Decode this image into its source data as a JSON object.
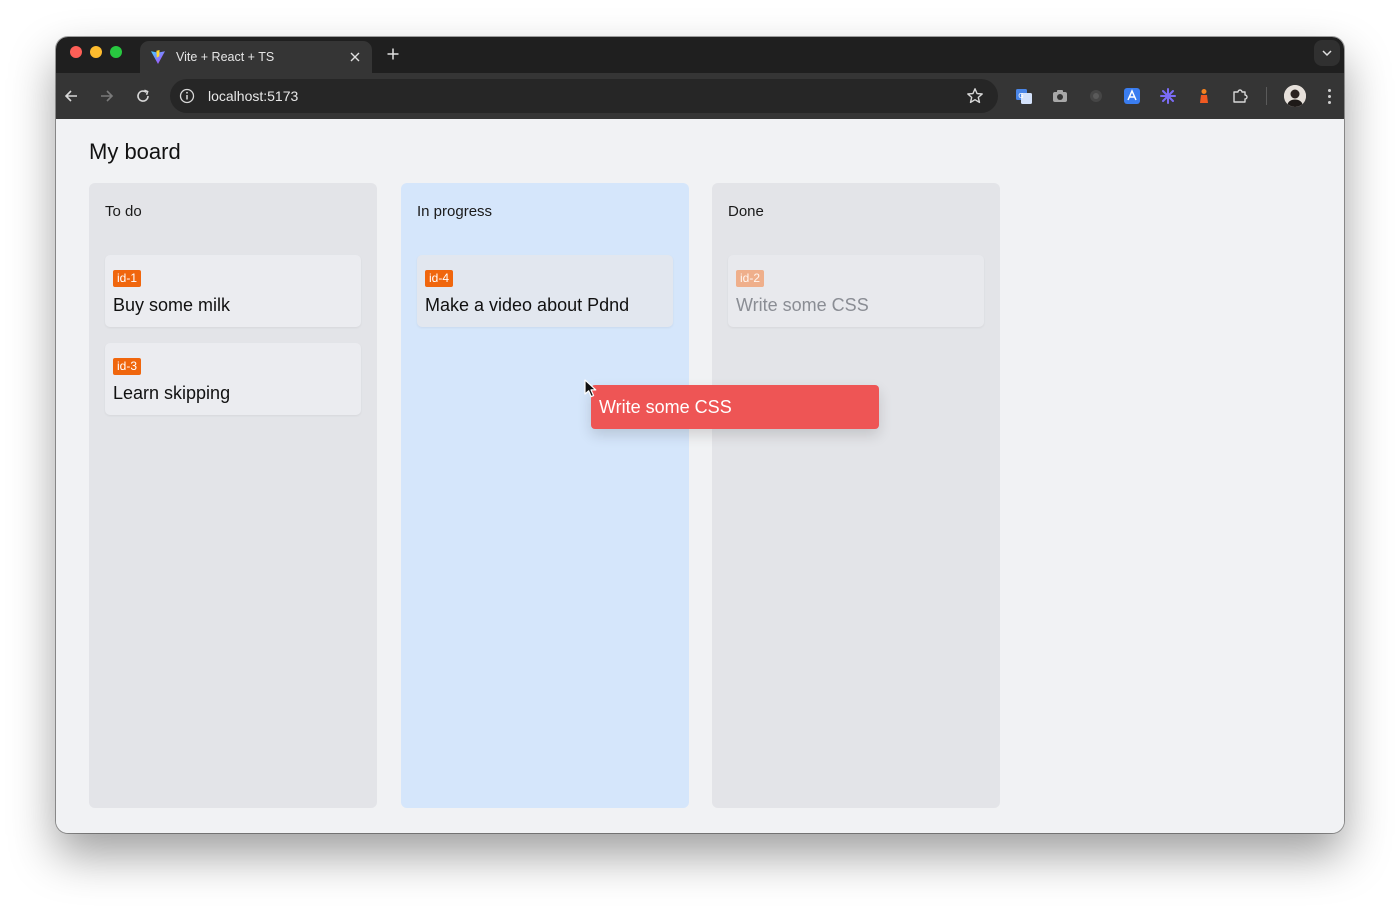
{
  "browser": {
    "tab": {
      "title": "Vite + React + TS"
    },
    "toolbar": {
      "url": "localhost:5173"
    },
    "colors": {
      "frame": "#1f1f1f",
      "toolbar": "#353535",
      "omnibox": "#262626"
    },
    "icons": [
      "back-icon",
      "forward-icon",
      "reload-icon",
      "site-info-icon",
      "bookmark-star-icon",
      "translate-icon",
      "camera-icon",
      "record-icon",
      "font-icon",
      "asterisk-icon",
      "chess-icon",
      "extensions-puzzle-icon",
      "profile-avatar",
      "kebab-menu-icon"
    ]
  },
  "board": {
    "title": "My board",
    "columns": [
      {
        "title": "To do",
        "cards": [
          {
            "id": "id-1",
            "text": "Buy some milk"
          },
          {
            "id": "id-3",
            "text": "Learn skipping"
          }
        ]
      },
      {
        "title": "In progress",
        "cards": [
          {
            "id": "id-4",
            "text": "Make a video about Pdnd"
          }
        ]
      },
      {
        "title": "Done",
        "cards": [
          {
            "id": "id-2",
            "text": "Write some CSS"
          }
        ]
      }
    ],
    "drag_preview": {
      "text": "Write some CSS"
    },
    "colors": {
      "id_badge": "#f0660d",
      "drag_preview": "#ee5555",
      "drop_target_column": "#d5e6fb",
      "column": "#e3e4e8"
    }
  }
}
